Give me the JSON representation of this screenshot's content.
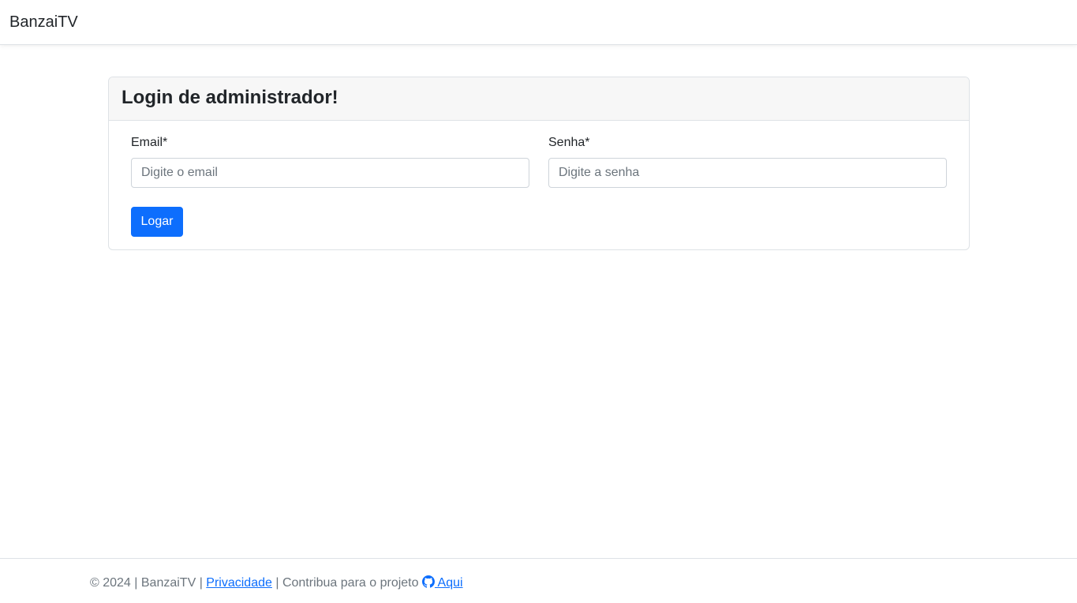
{
  "navbar": {
    "brand": "BanzaiTV"
  },
  "login_card": {
    "title": "Login de administrador!",
    "email_label": "Email*",
    "email_placeholder": "Digite o email",
    "email_value": "",
    "password_label": "Senha*",
    "password_placeholder": "Digite a senha",
    "password_value": "",
    "submit_label": "Logar"
  },
  "footer": {
    "prefix": "© 2024 | BanzaiTV | ",
    "privacy_link": "Privacidade",
    "middle": " | Contribua para o projeto ",
    "contribute_link": " Aqui",
    "contribute_icon": "github-icon"
  },
  "colors": {
    "primary": "#0d6efd",
    "card_header_bg": "#f7f7f7",
    "border": "#dee2e6",
    "muted_text": "#6c757d"
  }
}
